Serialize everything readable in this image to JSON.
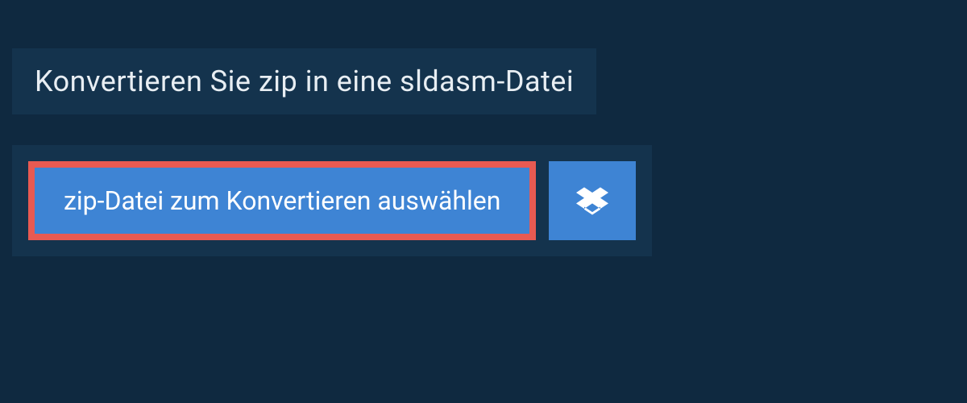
{
  "heading": "Konvertieren Sie zip in eine sldasm-Datei",
  "buttons": {
    "select_file": "zip-Datei zum Konvertieren auswählen"
  }
}
